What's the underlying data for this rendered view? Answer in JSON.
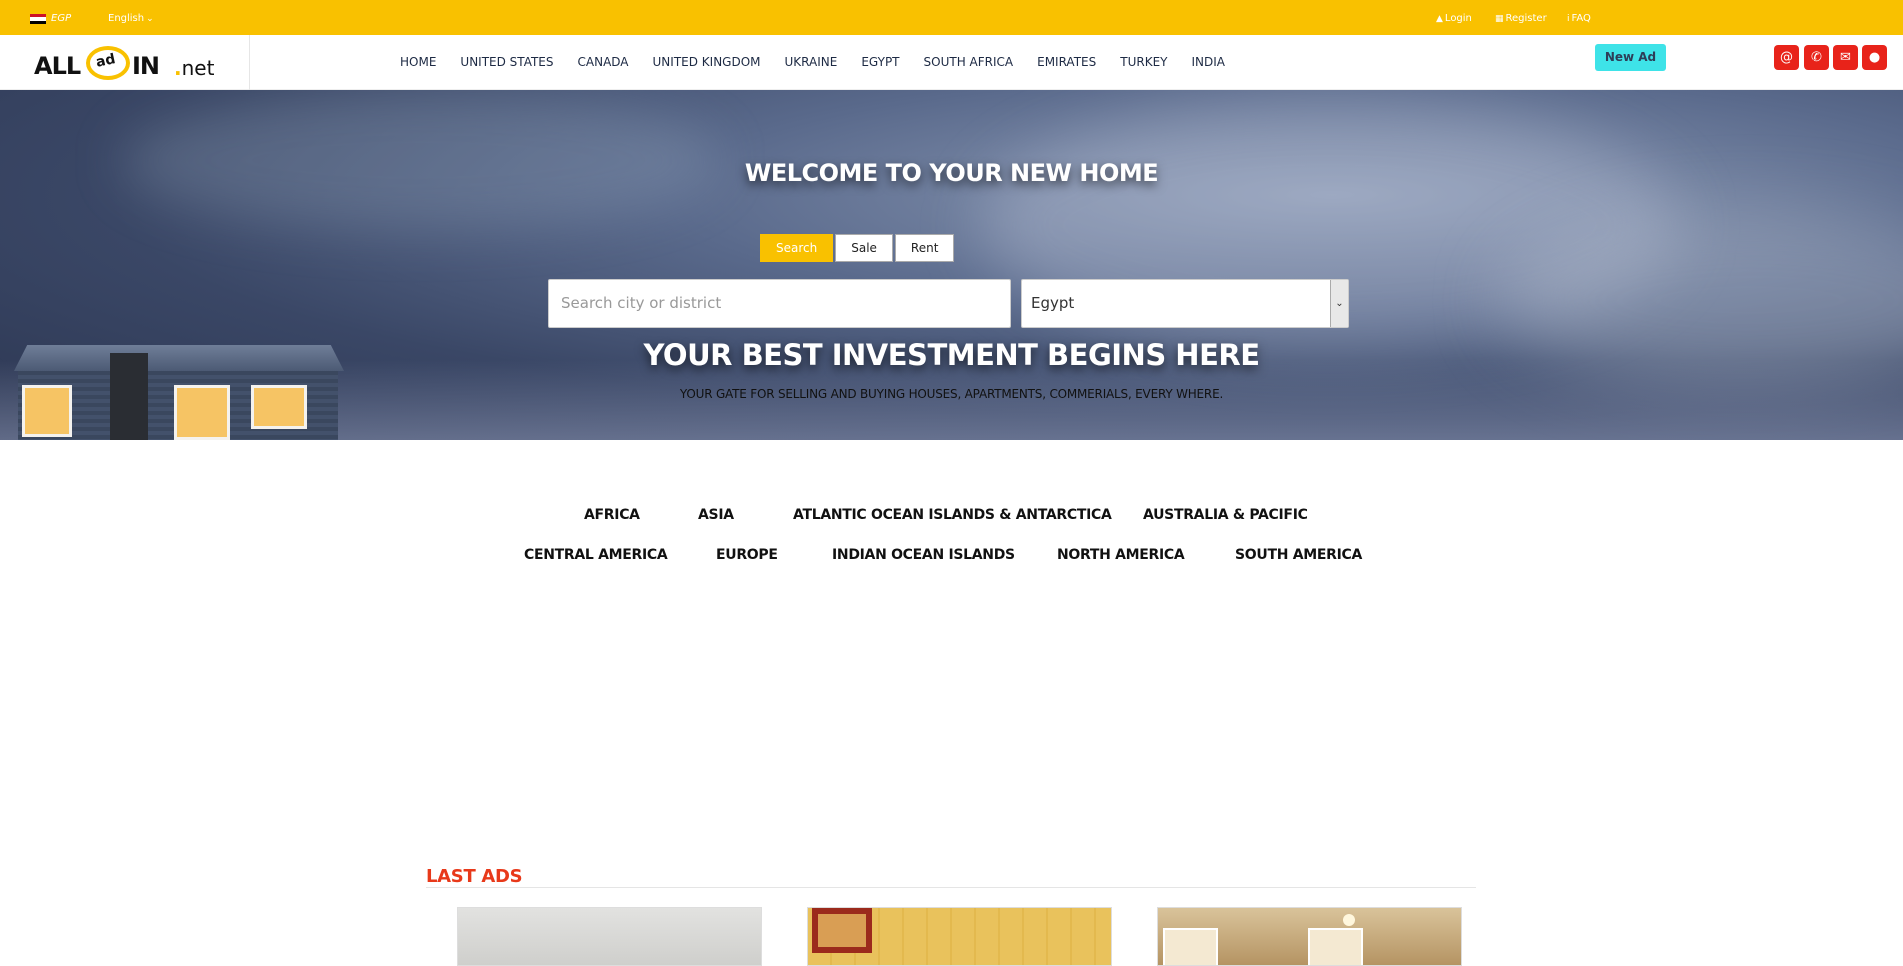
{
  "topbar": {
    "currency": "EGP",
    "language": "English",
    "links": [
      {
        "label": "Login",
        "icon": "user-icon"
      },
      {
        "label": "Register",
        "icon": "list-icon"
      },
      {
        "label": "FAQ",
        "icon": "info-icon"
      }
    ],
    "flag_colors": [
      "#ce1126",
      "#ffffff",
      "#000000"
    ]
  },
  "nav": {
    "logo_text": "ALL AD IN.net",
    "logo_parts": {
      "left": "ALL",
      "middle": "ad",
      "right": "IN",
      "dot": ".",
      "tld": "net"
    },
    "menu": [
      "HOME",
      "UNITED STATES",
      "CANADA",
      "UNITED KINGDOM",
      "UKRAINE",
      "EGYPT",
      "SOUTH AFRICA",
      "EMIRATES",
      "TURKEY",
      "INDIA"
    ],
    "new_ad": "New Ad",
    "contact_icons": [
      "at-icon",
      "phone-icon",
      "mail-icon",
      "location-pin-icon"
    ]
  },
  "hero": {
    "title": "WELCOME TO YOUR NEW HOME",
    "tabs": [
      "Search",
      "Sale",
      "Rent"
    ],
    "active_tab": "Search",
    "search_placeholder": "Search city or district",
    "country_selected": "Egypt",
    "headline": "YOUR BEST INVESTMENT BEGINS HERE",
    "tagline": "YOUR GATE FOR SELLING AND BUYING HOUSES, APARTMENTS, COMMERIALS, EVERY WHERE."
  },
  "regions": {
    "row1": [
      "AFRICA",
      "ASIA",
      "ATLANTIC OCEAN ISLANDS & ANTARCTICA",
      "AUSTRALIA & PACIFIC"
    ],
    "row2": [
      "CENTRAL AMERICA",
      "EUROPE",
      "INDIAN OCEAN ISLANDS",
      "NORTH AMERICA",
      "SOUTH AMERICA"
    ]
  },
  "last_ads": {
    "title": "LAST ADS"
  },
  "colors": {
    "accent_yellow": "#f9c100",
    "new_ad_bg": "#3ee3e8",
    "contact_red": "#e8231a",
    "last_ads_red": "#e8391a"
  }
}
